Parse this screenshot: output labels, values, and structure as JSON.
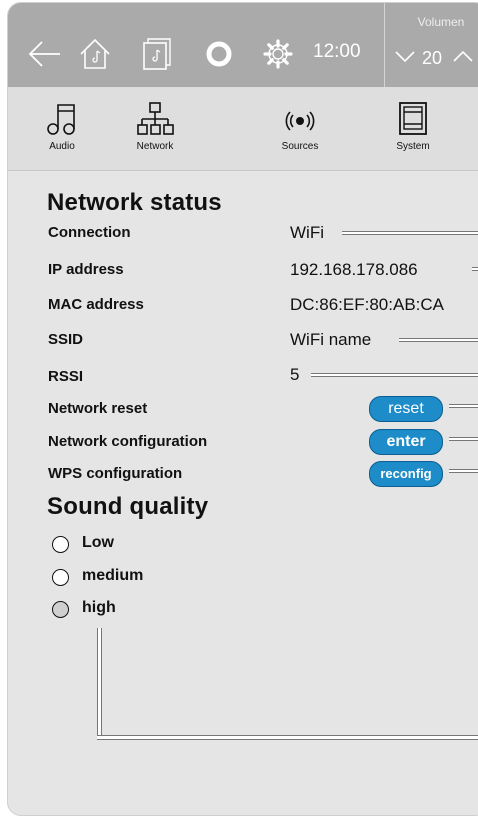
{
  "header": {
    "time": "12:00",
    "volume_title": "Volumen",
    "volume_value": "20"
  },
  "menu": [
    {
      "label": "Audio",
      "icon": "music-note-icon"
    },
    {
      "label": "Network",
      "icon": "network-icon"
    },
    {
      "label": "Sources",
      "icon": "broadcast-icon"
    },
    {
      "label": "System",
      "icon": "system-icon"
    }
  ],
  "network_status": {
    "title": "Network status",
    "connection": {
      "label": "Connection",
      "value": "WiFi"
    },
    "ip": {
      "label": "IP address",
      "value": "192.168.178.086"
    },
    "mac": {
      "label": "MAC address",
      "value": "DC:86:EF:80:AB:CA"
    },
    "ssid": {
      "label": "SSID",
      "value": "WiFi name"
    },
    "rssi": {
      "label": "RSSI",
      "value": "5"
    },
    "reset": {
      "label": "Network reset",
      "button": "reset"
    },
    "config": {
      "label": "Network configuration",
      "button": "enter"
    },
    "wps": {
      "label": "WPS configuration",
      "button": "reconfig"
    }
  },
  "sound_quality": {
    "title": "Sound quality",
    "options": [
      "Low",
      "medium",
      "high"
    ],
    "selected": "high"
  },
  "colors": {
    "topbar": "#aaaaaa",
    "background": "#e5e5e5",
    "button": "#1e8cc8"
  }
}
